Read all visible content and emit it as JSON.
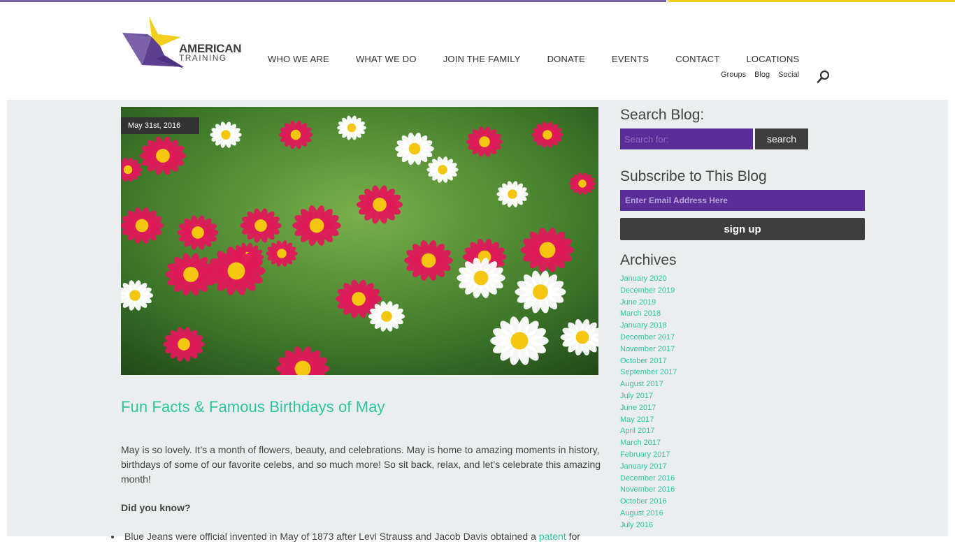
{
  "brand": {
    "line1": "AMERICAN",
    "line2": "TRAINING",
    "colors": {
      "purple": "#7b62a8",
      "yellow": "#f2cf1d",
      "teal": "#2fc4a0",
      "dark": "#3d3d3d",
      "field": "#5b2d98"
    }
  },
  "nav": {
    "main": [
      "WHO WE ARE",
      "WHAT WE DO",
      "JOIN THE FAMILY",
      "DONATE",
      "EVENTS",
      "CONTACT",
      "LOCATIONS"
    ],
    "sub": [
      "Groups",
      "Blog",
      "Social"
    ],
    "search_icon": "magnifier-icon"
  },
  "post": {
    "date": "May 31st, 2016",
    "image_alt": "Field of pink and white daisies",
    "title": "Fun Facts & Famous Birthdays of May",
    "intro": "May is so lovely.  It’s a month of flowers, beauty, and celebrations.  May is home to amazing moments in history, birthdays of some of our favorite celebs, and so much more! So sit back, relax, and let’s celebrate this amazing month!",
    "question": "Did you know?",
    "bullet_start": "Blue Jeans were official invented in May of 1873 after Levi Strauss and Jacob Davis obtained a ",
    "bullet_link": "patent",
    "bullet_end": " for"
  },
  "sidebar": {
    "search_heading": "Search Blog:",
    "search_placeholder": "Search for:",
    "search_button": "search",
    "subscribe_heading": "Subscribe to This Blog",
    "email_placeholder": "Enter Email Address Here",
    "signup_button": "sign up",
    "archives_heading": "Archives",
    "archives": [
      "January 2020",
      "December 2019",
      "June 2019",
      "March 2018",
      "January 2018",
      "December 2017",
      "November 2017",
      "October 2017",
      "September 2017",
      "August 2017",
      "July 2017",
      "June 2017",
      "May 2017",
      "April 2017",
      "March 2017",
      "February 2017",
      "January 2017",
      "December 2016",
      "November 2016",
      "October 2016",
      "August 2016",
      "July 2016"
    ]
  }
}
